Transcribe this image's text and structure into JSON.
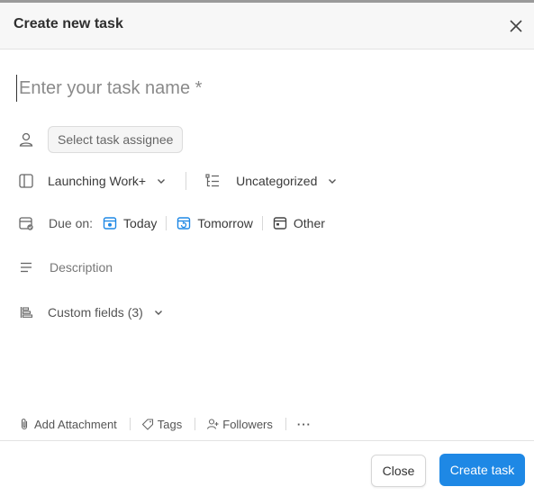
{
  "dialog": {
    "title": "Create new task",
    "close_icon": "close-icon"
  },
  "task_name": {
    "placeholder": "Enter your task name *",
    "value": ""
  },
  "assignee": {
    "icon": "person-icon",
    "button_label": "Select task assignee"
  },
  "project": {
    "icon": "panel-icon",
    "label": "Launching Work+"
  },
  "category": {
    "icon": "list-tree-icon",
    "label": "Uncategorized"
  },
  "due": {
    "icon": "calendar-check-icon",
    "label": "Due on:",
    "options": [
      {
        "label": "Today",
        "icon": "calendar-today-icon"
      },
      {
        "label": "Tomorrow",
        "icon": "calendar-tomorrow-icon"
      },
      {
        "label": "Other",
        "icon": "calendar-other-icon"
      }
    ],
    "accent_color": "#1e88e5"
  },
  "description": {
    "icon": "text-lines-icon",
    "placeholder": "Description"
  },
  "custom_fields": {
    "icon": "custom-fields-icon",
    "label": "Custom fields (3)"
  },
  "footer_links": {
    "attachment": "Add Attachment",
    "tags": "Tags",
    "followers": "Followers",
    "more": "···"
  },
  "actions": {
    "close_label": "Close",
    "create_label": "Create task",
    "create_color": "#1e88e5"
  }
}
